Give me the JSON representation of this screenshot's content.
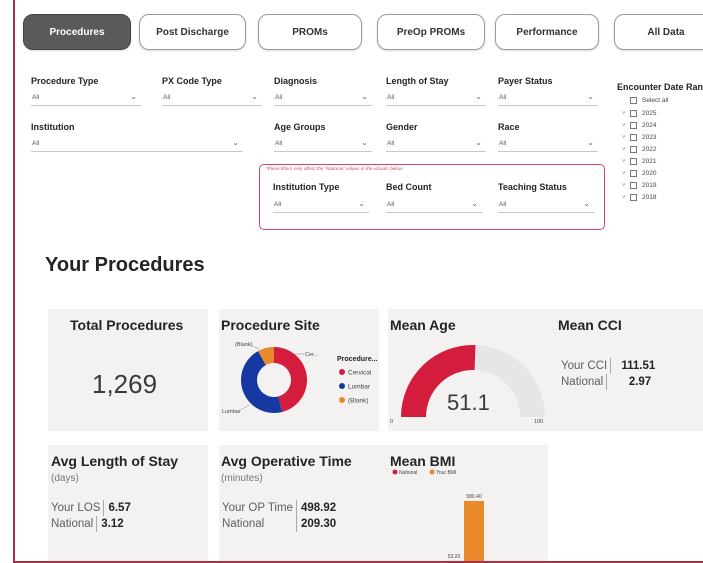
{
  "tabs": [
    "Procedures",
    "Post Discharge",
    "PROMs",
    "PreOp PROMs",
    "Performance",
    "All Data"
  ],
  "filters": {
    "procedure_type": {
      "label": "Procedure Type",
      "value": "All"
    },
    "px_code_type": {
      "label": "PX Code Type",
      "value": "All"
    },
    "diagnosis": {
      "label": "Diagnosis",
      "value": "All"
    },
    "length_of_stay": {
      "label": "Length of Stay",
      "value": "All"
    },
    "payer_status": {
      "label": "Payer Status",
      "value": "All"
    },
    "institution": {
      "label": "Institution",
      "value": "All"
    },
    "age_groups": {
      "label": "Age Groups",
      "value": "All"
    },
    "gender": {
      "label": "Gender",
      "value": "All"
    },
    "race": {
      "label": "Race",
      "value": "All"
    },
    "national_note": "*these filters only affect the 'National' values in the visuals below",
    "institution_type": {
      "label": "Institution Type",
      "value": "All"
    },
    "bed_count": {
      "label": "Bed Count",
      "value": "All"
    },
    "teaching_status": {
      "label": "Teaching Status",
      "value": "All"
    }
  },
  "encounter_date": {
    "header": "Encounter Date Rang",
    "select_all": "Select all",
    "years": [
      "2025",
      "2024",
      "2023",
      "2022",
      "2021",
      "2020",
      "2019",
      "2018"
    ]
  },
  "section_title": "Your Procedures",
  "cards": {
    "total_procedures": {
      "title": "Total Procedures",
      "value": "1,269"
    },
    "procedure_site": {
      "title": "Procedure Site",
      "legend_title": "Procedure...",
      "slice_labels": {
        "blank": "(Blank)",
        "cervical": "Cer...",
        "lumbar": "Lumbar"
      }
    },
    "mean_age": {
      "title": "Mean Age",
      "value": "51.1",
      "min_label": "0",
      "max_label": "100"
    },
    "mean_cci": {
      "title": "Mean CCI",
      "rows": [
        {
          "label": "Your CCI",
          "value": "111.51"
        },
        {
          "label": "National",
          "value": "2.97"
        }
      ]
    },
    "avg_los": {
      "title": "Avg Length of Stay",
      "subtitle": "(days)",
      "rows": [
        {
          "label": "Your LOS",
          "value": "6.57"
        },
        {
          "label": "National",
          "value": "3.12"
        }
      ]
    },
    "avg_op_time": {
      "title": "Avg Operative Time",
      "subtitle": "(minutes)",
      "rows": [
        {
          "label": "Your OP Time",
          "value": "498.92"
        },
        {
          "label": "National",
          "value": "209.30"
        }
      ]
    },
    "mean_bmi": {
      "title": "Mean BMI"
    }
  },
  "colors": {
    "accent": "#a3324c",
    "cervical": "#d41c3c",
    "lumbar": "#1638a3",
    "blank": "#e8892c",
    "gauge": "#d41c3c"
  },
  "chart_data": [
    {
      "type": "pie",
      "title": "Procedure Site",
      "legend_title": "Procedure...",
      "categories": [
        "Cervical",
        "Lumbar",
        "(Blank)"
      ],
      "values": [
        46,
        46,
        8
      ]
    },
    {
      "type": "bar",
      "title": "Mean BMI",
      "categories": [
        ""
      ],
      "series": [
        {
          "name": "National",
          "values": [
            53.2
          ]
        },
        {
          "name": "Your BMI",
          "values": [
            580.4
          ]
        }
      ],
      "data_labels": [
        "53.20",
        "580.40"
      ]
    },
    {
      "type": "gauge",
      "title": "Mean Age",
      "value": 51.1,
      "min": 0,
      "max": 100
    }
  ]
}
